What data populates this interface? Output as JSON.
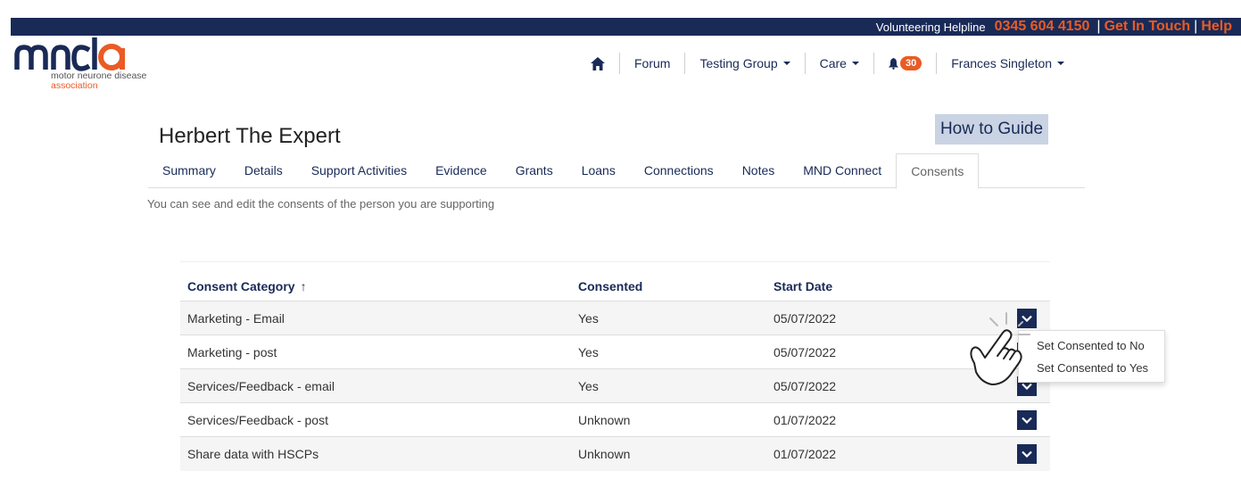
{
  "topbar": {
    "helpline_label": "Volunteering Helpline",
    "phone": "0345 604 4150",
    "get_in_touch": "Get In Touch",
    "help": "Help",
    "separator": "|"
  },
  "logo": {
    "tagline_line1": "motor neurone disease",
    "tagline_line2": "association"
  },
  "nav": {
    "forum": "Forum",
    "testing_group": "Testing Group",
    "care": "Care",
    "notifications_count": "30",
    "user_name": "Frances Singleton"
  },
  "page": {
    "title": "Herbert The Expert",
    "how_to_guide": "How to Guide",
    "description": "You can see and edit the consents of the person you are supporting"
  },
  "tabs": [
    {
      "label": "Summary"
    },
    {
      "label": "Details"
    },
    {
      "label": "Support Activities"
    },
    {
      "label": "Evidence"
    },
    {
      "label": "Grants"
    },
    {
      "label": "Loans"
    },
    {
      "label": "Connections"
    },
    {
      "label": "Notes"
    },
    {
      "label": "MND Connect"
    },
    {
      "label": "Consents"
    }
  ],
  "active_tab": "Consents",
  "table": {
    "headers": {
      "category": "Consent Category",
      "consented": "Consented",
      "start_date": "Start Date"
    },
    "sort_indicator": "↑",
    "rows": [
      {
        "category": "Marketing - Email",
        "consented": "Yes",
        "start_date": "05/07/2022"
      },
      {
        "category": "Marketing - post",
        "consented": "Yes",
        "start_date": "05/07/2022"
      },
      {
        "category": "Services/Feedback - email",
        "consented": "Yes",
        "start_date": "05/07/2022"
      },
      {
        "category": "Services/Feedback - post",
        "consented": "Unknown",
        "start_date": "01/07/2022"
      },
      {
        "category": "Share data with HSCPs",
        "consented": "Unknown",
        "start_date": "01/07/2022"
      }
    ]
  },
  "menu": {
    "set_no": "Set Consented to No",
    "set_yes": "Set Consented to Yes"
  },
  "icons": {
    "home": "home-icon",
    "bell": "bell-icon",
    "chevron": "chevron-down-icon",
    "pointer": "hand-pointer-icon"
  },
  "colors": {
    "navy": "#192a57",
    "orange": "#ea5b25",
    "guide_bg": "#c9d3e3"
  }
}
